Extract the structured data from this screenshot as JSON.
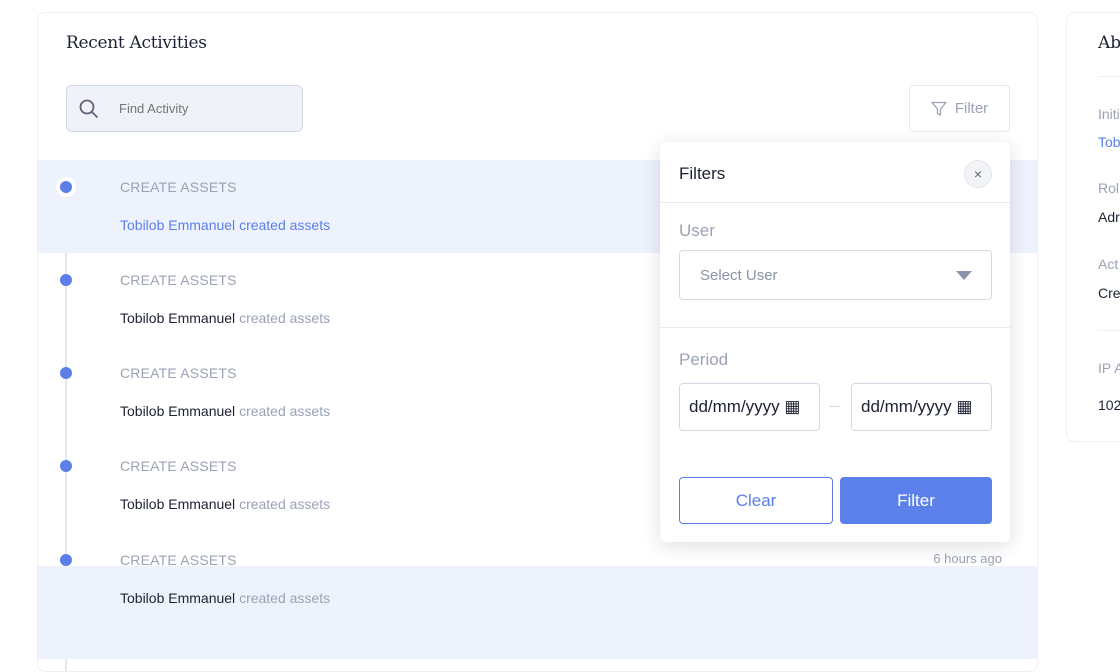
{
  "panel": {
    "title": "Recent Activities",
    "search_placeholder": "Find Activity",
    "filter_label": "Filter"
  },
  "activities": [
    {
      "label": "CREATE ASSETS",
      "user": "Tobilob Emmanuel",
      "action": "created assets",
      "time": "",
      "highlighted": true
    },
    {
      "label": "CREATE ASSETS",
      "user": "Tobilob Emmanuel",
      "action": "created assets",
      "time": ""
    },
    {
      "label": "CREATE ASSETS",
      "user": "Tobilob Emmanuel",
      "action": "created assets",
      "time": ""
    },
    {
      "label": "CREATE ASSETS",
      "user": "Tobilob Emmanuel",
      "action": "created assets",
      "time": ""
    },
    {
      "label": "CREATE ASSETS",
      "user": "Tobilob Emmanuel",
      "action": "created assets",
      "time": "6 hours ago"
    }
  ],
  "side": {
    "title": "Abo",
    "items": [
      "Initi",
      "Tob",
      "Rol",
      "Adr",
      "Act",
      "Cre",
      "IP A",
      "102"
    ]
  },
  "filters": {
    "title": "Filters",
    "close": "×",
    "user_label": "User",
    "user_placeholder": "Select User",
    "period_label": "Period",
    "from_placeholder": "dd/mm/yyyy",
    "to_placeholder": "dd/mm/yyyy",
    "clear_label": "Clear",
    "apply_label": "Filter"
  },
  "colors": {
    "accent": "#5b7fe6",
    "highlight": "#eef2fd"
  }
}
